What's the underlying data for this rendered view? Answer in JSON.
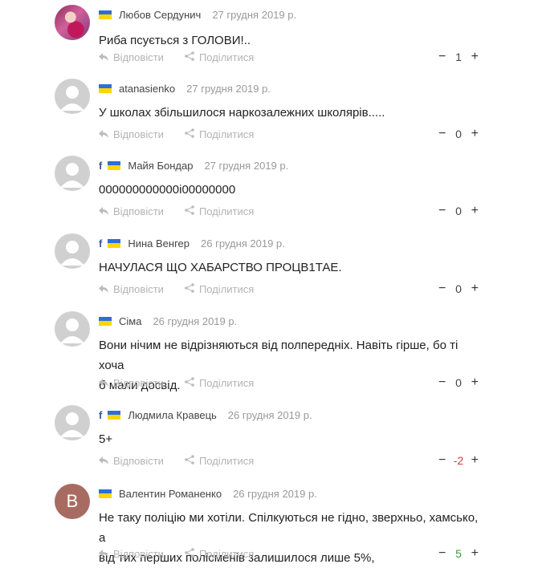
{
  "labels": {
    "reply": "Відповісти",
    "share": "Поділитися",
    "minus": "−",
    "plus": "+"
  },
  "colors": {
    "flag_blue": "#2d6fd6",
    "flag_yellow": "#ffd500",
    "facebook": "#3b5998",
    "positive": "#3a9d3a",
    "negative": "#d23a3a"
  },
  "comments": [
    {
      "author": "Любов Сердунич",
      "date": "27 грудня 2019 р.",
      "fb": "",
      "avatar": "photo",
      "avatar_letter": "",
      "lines": [
        "Риба псується з ГОЛОВИ!.."
      ],
      "votes": "1",
      "vote_color": "zero"
    },
    {
      "author": "atanasienko",
      "date": "27 грудня 2019 р.",
      "fb": "",
      "avatar": "generic",
      "avatar_letter": "",
      "lines": [
        "У школах збільшилося наркозалежних школярів....."
      ],
      "votes": "0",
      "vote_color": "zero"
    },
    {
      "author": "Майя Бондар",
      "date": "27 грудня 2019 р.",
      "fb": "f",
      "avatar": "generic",
      "avatar_letter": "",
      "lines": [
        "000000000000і00000000"
      ],
      "votes": "0",
      "vote_color": "zero"
    },
    {
      "author": "Нина Венгер",
      "date": "26 грудня 2019 р.",
      "fb": "f",
      "avatar": "generic",
      "avatar_letter": "",
      "lines": [
        "НАЧУЛАСЯ ЩО ХАБАРСТВО ПРОЦВ1ТАЕ."
      ],
      "votes": "0",
      "vote_color": "zero"
    },
    {
      "author": "Сіма",
      "date": "26 грудня 2019 р.",
      "fb": "",
      "avatar": "generic",
      "avatar_letter": "",
      "lines": [
        "Вони нічим не відрізняються від полпередніх. Навіть гірше, бо ті хоча",
        "б мали досвід."
      ],
      "votes": "0",
      "vote_color": "zero"
    },
    {
      "author": "Людмила Кравець",
      "date": "26 грудня 2019 р.",
      "fb": "f",
      "avatar": "generic",
      "avatar_letter": "",
      "lines": [
        "5+"
      ],
      "votes": "-2",
      "vote_color": "neg"
    },
    {
      "author": "Валентин Романенко",
      "date": "26 грудня 2019 р.",
      "fb": "",
      "avatar": "letter",
      "avatar_letter": "В",
      "lines": [
        "Не таку поліцію ми хотіли. Спілкуються не гідно, зверхньо, хамсько, а",
        "від тих перших полісменів залишилося лише 5%,"
      ],
      "votes": "5",
      "vote_color": "pos"
    }
  ]
}
